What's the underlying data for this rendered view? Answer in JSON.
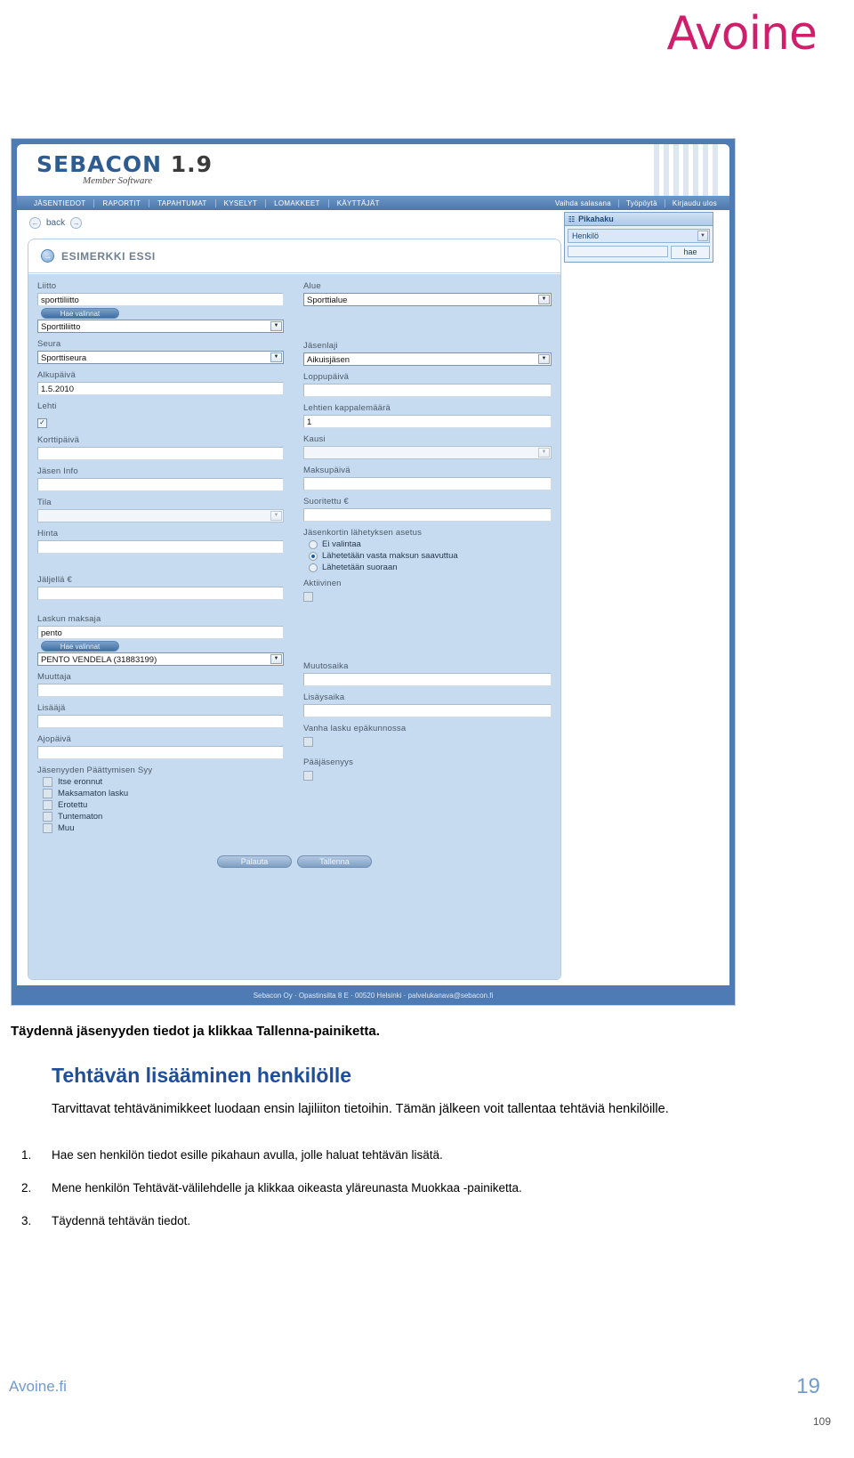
{
  "brand": {
    "logo_text": "Avoine"
  },
  "app": {
    "logo": "SEBACON",
    "version": "1.9",
    "tagline": "Member Software",
    "nav_left": [
      "JÄSENTIEDOT",
      "RAPORTIT",
      "TAPAHTUMAT",
      "KYSELYT",
      "LOMAKKEET",
      "KÄYTTÄJÄT"
    ],
    "nav_right": [
      "Vaihda salasana",
      "Työpöytä",
      "Kirjaudu ulos"
    ],
    "back_label": "back",
    "record_title": "ESIMERKKI ESSI",
    "footer": "Sebacon Oy · Opastinsilta 8 E · 00520 Helsinki · palvelukanava@sebacon.fi"
  },
  "quick_search": {
    "title": "Pikahaku",
    "type_value": "Henkilö",
    "input_value": "",
    "button_label": "hae"
  },
  "form": {
    "left": {
      "liitto_label": "Liitto",
      "liitto_value": "sporttiliitto",
      "liitto_hae_label": "Hae valinnat",
      "liitto_select_value": "Sporttiliitto",
      "seura_label": "Seura",
      "seura_value": "Sporttiseura",
      "alkupaiva_label": "Alkupäivä",
      "alkupaiva_value": "1.5.2010",
      "lehti_label": "Lehti",
      "lehti_checked": "✓",
      "korttipaiva_label": "Korttipäivä",
      "korttipaiva_value": "",
      "jasen_info_label": "Jäsen Info",
      "jasen_info_value": "",
      "tila_label": "Tila",
      "tila_value": "",
      "hinta_label": "Hinta",
      "hinta_value": "",
      "jaljella_label": "Jäljellä €",
      "jaljella_value": "",
      "maksaja_label": "Laskun maksaja",
      "maksaja_value": "pento",
      "maksaja_hae_label": "Hae valinnat",
      "maksaja_select_value": "PENTO VENDELA (31883199)",
      "muuttaja_label": "Muuttaja",
      "muuttaja_value": "",
      "lisaaja_label": "Lisääjä",
      "lisaaja_value": "",
      "ajopaiva_label": "Ajopäivä",
      "ajopaiva_value": "",
      "paattymis_label": "Jäsenyyden Päättymisen Syy",
      "paattymis_options": [
        "Itse eronnut",
        "Maksamaton lasku",
        "Erotettu",
        "Tuntematon",
        "Muu"
      ]
    },
    "right": {
      "alue_label": "Alue",
      "alue_value": "Sporttialue",
      "jasenlaji_label": "Jäsenlaji",
      "jasenlaji_value": "Aikuisjäsen",
      "loppupaiva_label": "Loppupäivä",
      "loppupaiva_value": "",
      "lehtien_label": "Lehtien kappalemäärä",
      "lehtien_value": "1",
      "kausi_label": "Kausi",
      "kausi_value": "",
      "maksupaiva_label": "Maksupäivä",
      "maksupaiva_value": "",
      "suoritettu_label": "Suoritettu €",
      "suoritettu_value": "",
      "kortti_label": "Jäsenkortin lähetyksen asetus",
      "kortti_options": [
        "Ei valintaa",
        "Lähetetään vasta maksun saavuttua",
        "Lähetetään suoraan"
      ],
      "kortti_selected_index": 1,
      "aktiivinen_label": "Aktiivinen",
      "muutosaika_label": "Muutosaika",
      "muutosaika_value": "",
      "lisaysaika_label": "Lisäysaika",
      "lisaysaika_value": "",
      "vanha_lasku_label": "Vanha lasku epäkunnossa",
      "paajasenyys_label": "Pääjäsenyys"
    },
    "buttons": {
      "reset": "Palauta",
      "save": "Tallenna"
    }
  },
  "doc": {
    "intro": "Täydennä jäsenyyden tiedot ja klikkaa Tallenna-painiketta.",
    "heading": "Tehtävän lisääminen henkilölle",
    "paragraph": "Tarvittavat tehtävänimikkeet luodaan ensin lajiliiton tietoihin. Tämän jälkeen voit tallentaa tehtäviä henkilöille.",
    "steps": [
      {
        "num": "1.",
        "text": "Hae sen henkilön tiedot esille pikahaun avulla, jolle haluat tehtävän lisätä."
      },
      {
        "num": "2.",
        "text": "Mene henkilön Tehtävät-välilehdelle ja klikkaa oikeasta yläreunasta Muokkaa -painiketta."
      },
      {
        "num": "3.",
        "text": "Täydennä tehtävän tiedot."
      }
    ],
    "footer_left": "Avoine.fi",
    "footer_right": "19",
    "footer_page": "109"
  },
  "colors": {
    "brand_pink": "#cf1f6b",
    "app_blue": "#4f7bb5",
    "form_bg": "#c6dbf0",
    "heading_blue": "#1f4e9c"
  }
}
